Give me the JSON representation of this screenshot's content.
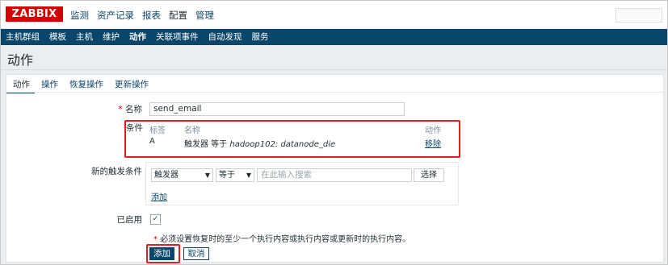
{
  "top": {
    "logo": "ZABBIX",
    "menu": [
      "监测",
      "资产记录",
      "报表",
      "配置",
      "管理"
    ],
    "active_menu_index": 3
  },
  "subnav": {
    "items": [
      "主机群组",
      "模板",
      "主机",
      "维护",
      "动作",
      "关联项事件",
      "自动发现",
      "服务"
    ],
    "active_index": 4
  },
  "page": {
    "title": "动作"
  },
  "tabs": [
    "动作",
    "操作",
    "恢复操作",
    "更新操作"
  ],
  "form": {
    "name_label": "名称",
    "name_value": "send_email",
    "conditions_label": "条件",
    "conditions": {
      "header_label": "标签",
      "header_name": "名称",
      "header_action": "动作",
      "rows": [
        {
          "label": "A",
          "name_prefix": "触发器 等于 ",
          "name_value": "hadoop102: datanode_die",
          "action": "移除"
        }
      ]
    },
    "new_condition_label": "新的触发条件",
    "new_condition": {
      "type_value": "触发器",
      "operator_value": "等于",
      "search_placeholder": "在此输入搜索",
      "select_label": "选择",
      "add_label": "添加"
    },
    "enabled_label": "已启用",
    "enabled": true,
    "hint": "必须设置恢复时的至少一个执行内容或执行内容或更新时的执行内容。",
    "add_button": "添加",
    "cancel_button": "取消"
  },
  "colors": {
    "brand": "#d40000",
    "nav": "#0a466a",
    "highlight": "#e02020"
  }
}
